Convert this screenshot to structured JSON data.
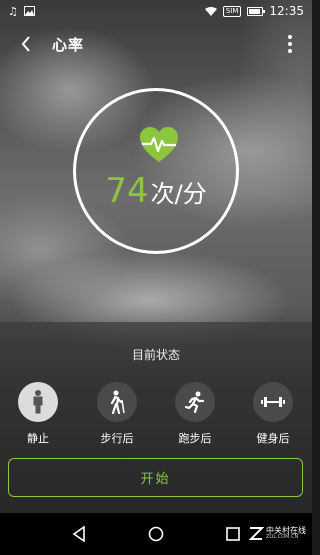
{
  "status_bar": {
    "time": "12:35",
    "sim_label": "SIM",
    "battery_level": 0.85
  },
  "header": {
    "title": "心率"
  },
  "heart_rate": {
    "value": "74",
    "unit": "次/分"
  },
  "colors": {
    "accent": "#8cc63f"
  },
  "states_section": {
    "title": "目前状态",
    "items": [
      {
        "label": "静止",
        "icon": "standing-person-icon",
        "active": true
      },
      {
        "label": "步行后",
        "icon": "walking-person-icon",
        "active": false
      },
      {
        "label": "跑步后",
        "icon": "running-person-icon",
        "active": false
      },
      {
        "label": "健身后",
        "icon": "dumbbell-icon",
        "active": false
      }
    ]
  },
  "start_button": {
    "label": "开始"
  },
  "watermark": {
    "name": "中关村在线",
    "domain": "ZOL.COM.CN"
  }
}
